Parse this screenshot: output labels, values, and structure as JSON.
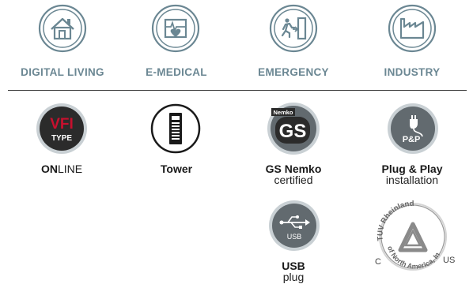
{
  "categories": [
    {
      "label": "DIGITAL LIVING",
      "icon": "house-icon"
    },
    {
      "label": "E-MEDICAL",
      "icon": "medical-monitor-icon"
    },
    {
      "label": "EMERGENCY",
      "icon": "emergency-exit-icon"
    },
    {
      "label": "INDUSTRY",
      "icon": "factory-icon"
    }
  ],
  "features": {
    "vfi": {
      "badge_top": "VFI",
      "badge_bottom": "TYPE",
      "label_bold": "ON",
      "label_rest": "LINE"
    },
    "tower": {
      "label": "Tower"
    },
    "gs": {
      "badge_text": "Nemko",
      "label": "GS Nemko",
      "sub": "certified"
    },
    "plug_play": {
      "badge_text": "P&P",
      "label": "Plug & Play",
      "sub": "installation"
    },
    "usb": {
      "badge_text": "USB",
      "label": "USB",
      "sub": "plug"
    },
    "tuv": {
      "arc_top": "TUV Rheinland",
      "arc_bottom": "of North America, Inc.",
      "left": "C",
      "right": "US"
    }
  },
  "colors": {
    "category_teal": "#6b8793",
    "badge_dark": "#2b2b2b",
    "badge_red": "#c8102e",
    "badge_grey": "#626a6f"
  }
}
